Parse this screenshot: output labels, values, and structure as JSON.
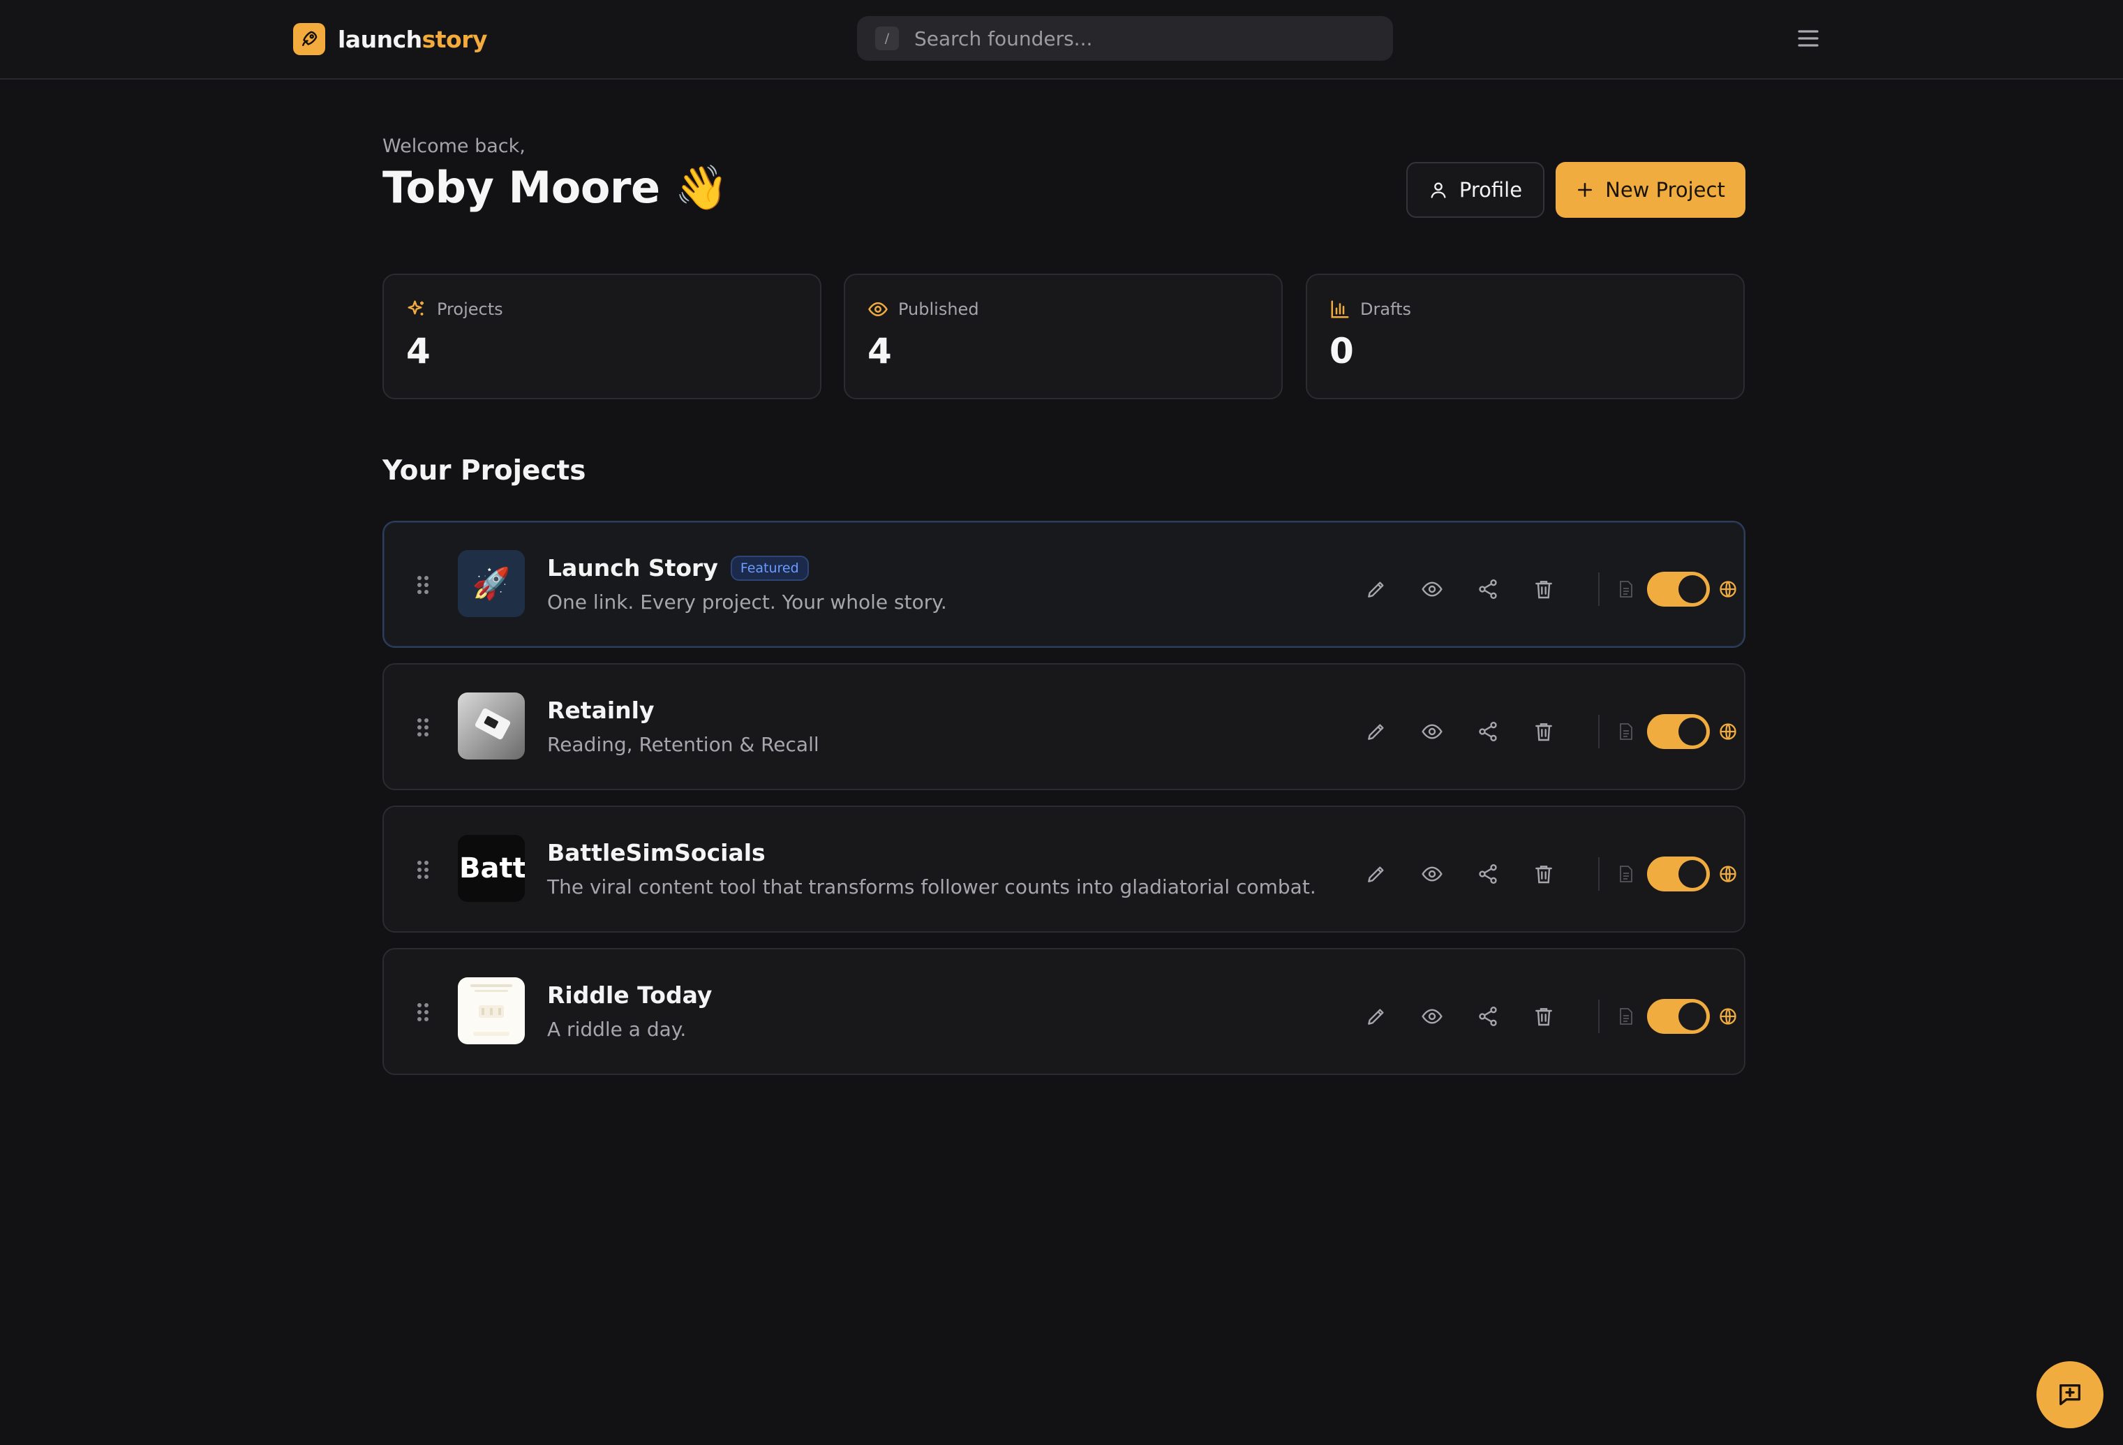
{
  "brand": {
    "name_part1": "launch",
    "name_part2": "story",
    "accent": "#f0ac3e"
  },
  "search": {
    "shortcut_key": "/",
    "placeholder": "Search founders..."
  },
  "header": {
    "welcome": "Welcome back,",
    "username": "Toby Moore 👋",
    "profile_label": "Profile",
    "new_project_label": "New Project"
  },
  "stats": [
    {
      "label": "Projects",
      "value": "4",
      "icon": "sparkles-icon"
    },
    {
      "label": "Published",
      "value": "4",
      "icon": "eye-icon"
    },
    {
      "label": "Drafts",
      "value": "0",
      "icon": "bar-chart-icon"
    }
  ],
  "projects_section_title": "Your Projects",
  "projects": [
    {
      "title": "Launch Story",
      "badge": "Featured",
      "description": "One link. Every project. Your whole story.",
      "published": true,
      "thumb_text": "🚀"
    },
    {
      "title": "Retainly",
      "badge": "",
      "description": "Reading, Retention & Recall",
      "published": true,
      "thumb_text": ""
    },
    {
      "title": "BattleSimSocials",
      "badge": "",
      "description": "The viral content tool that transforms follower counts into gladiatorial combat.",
      "published": true,
      "thumb_text": "Battle"
    },
    {
      "title": "Riddle Today",
      "badge": "",
      "description": "A riddle a day.",
      "published": true,
      "thumb_text": ""
    }
  ],
  "colors": {
    "background": "#121214",
    "card": "#18181b",
    "featured_border": "#2e3f5c",
    "badge_text": "#6b9cff"
  }
}
